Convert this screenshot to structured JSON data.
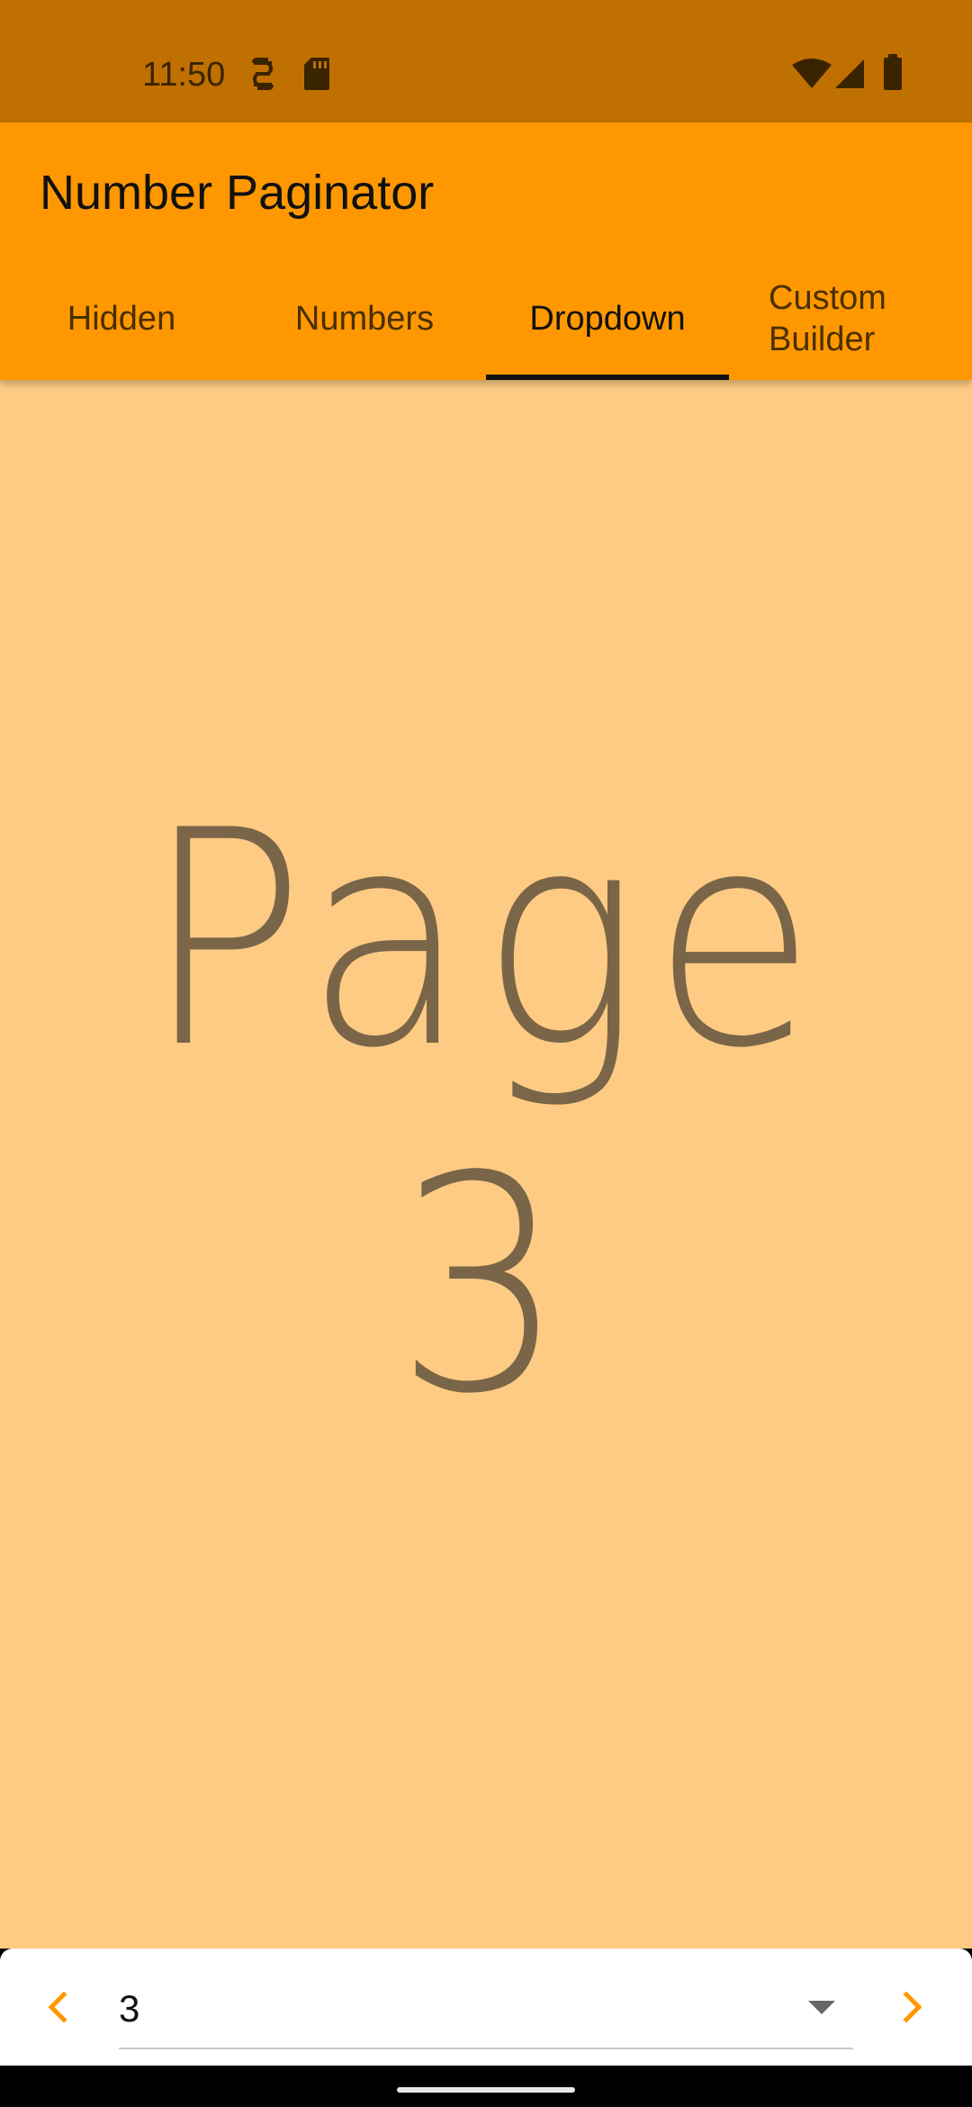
{
  "status_bar": {
    "time": "11:50",
    "left_icons": [
      "sync-icon",
      "sd-card-icon"
    ],
    "right_icons": [
      "wifi-icon",
      "signal-icon",
      "battery-icon"
    ]
  },
  "app_bar": {
    "title": "Number Paginator",
    "background_color": "#ff9800"
  },
  "tabs": [
    {
      "label": "Hidden",
      "active": false
    },
    {
      "label": "Numbers",
      "active": false
    },
    {
      "label": "Dropdown",
      "active": true
    },
    {
      "label": "Custom\nBuilder",
      "active": false
    }
  ],
  "content": {
    "page_label": "Page 3",
    "background_color": "#fdcb83"
  },
  "paginator": {
    "prev_icon": "chevron-left-icon",
    "next_icon": "chevron-right-icon",
    "selected_page": "3",
    "dropdown_icon": "arrow-drop-down-icon",
    "accent_color": "#ff9800"
  }
}
